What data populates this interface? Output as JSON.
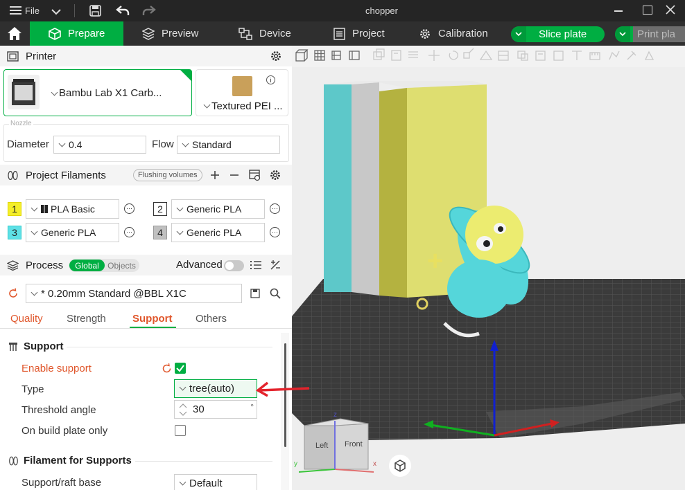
{
  "app": {
    "title": "chopper",
    "menu_label": "File"
  },
  "tabs": [
    {
      "label": "Prepare"
    },
    {
      "label": "Preview"
    },
    {
      "label": "Device"
    },
    {
      "label": "Project"
    },
    {
      "label": "Calibration"
    }
  ],
  "actions": {
    "slice": "Slice plate",
    "print": "Print pla"
  },
  "printer": {
    "section": "Printer",
    "name": "Bambu Lab X1 Carb...",
    "plate": "Textured PEI ...",
    "nozzle_group": "Nozzle",
    "diameter_label": "Diameter",
    "diameter": "0.4",
    "flow_label": "Flow",
    "flow": "Standard"
  },
  "filaments": {
    "section": "Project Filaments",
    "flushing": "Flushing volumes",
    "items": [
      {
        "num": "1",
        "name": "PLA Basic",
        "color": "#f4ee2a"
      },
      {
        "num": "2",
        "name": "Generic PLA",
        "color": "#ffffff"
      },
      {
        "num": "3",
        "name": "Generic PLA",
        "color": "#5ee0e6"
      },
      {
        "num": "4",
        "name": "Generic PLA",
        "color": "#c0c0c0"
      }
    ]
  },
  "process": {
    "section": "Process",
    "global": "Global",
    "objects": "Objects",
    "advanced": "Advanced",
    "preset": "* 0.20mm Standard @BBL X1C",
    "subtabs": [
      "Quality",
      "Strength",
      "Support",
      "Others"
    ],
    "active_subtab": "Support"
  },
  "support": {
    "heading": "Support",
    "enable_label": "Enable support",
    "enable_checked": true,
    "type_label": "Type",
    "type_value": "tree(auto)",
    "threshold_label": "Threshold angle",
    "threshold_value": "30",
    "threshold_unit": "°",
    "buildplate_label": "On build plate only",
    "buildplate_checked": false,
    "filament_heading": "Filament for Supports",
    "raft_label": "Support/raft base",
    "raft_value": "Default"
  },
  "viewcube": {
    "left": "Left",
    "front": "Front",
    "axis_x": "x",
    "axis_y": "y",
    "axis_z": "z"
  },
  "colors": {
    "accent": "#00ae42",
    "orange": "#e0562b",
    "arrow": "#e3232c"
  }
}
